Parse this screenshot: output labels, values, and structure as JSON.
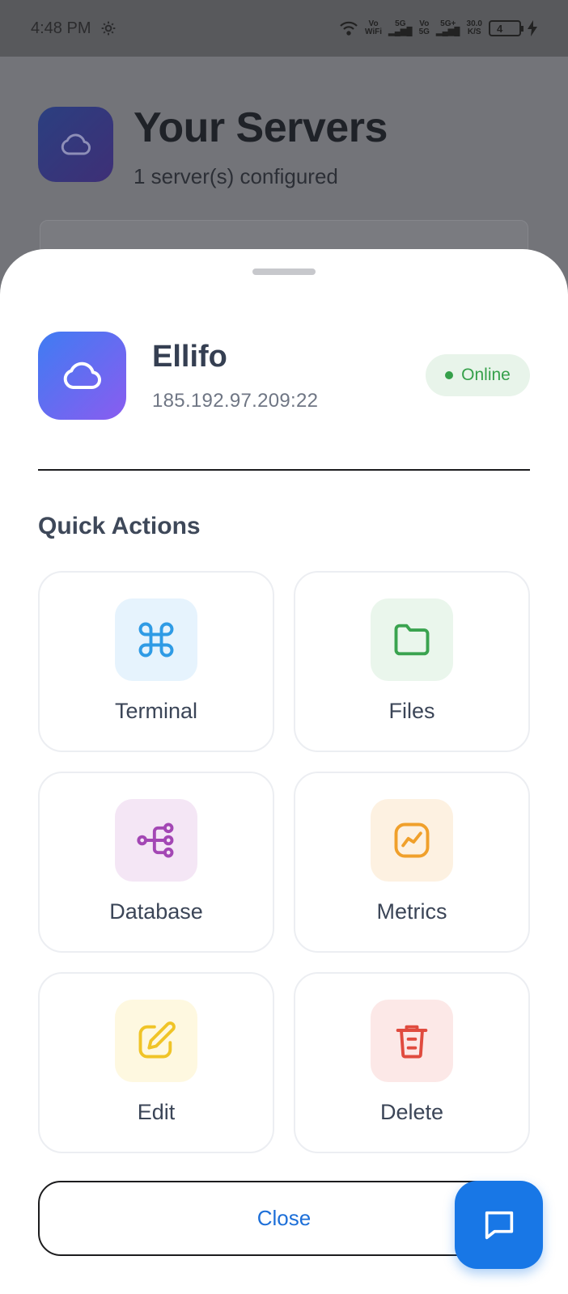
{
  "status_bar": {
    "time": "4:48 PM",
    "net1_top": "Vo",
    "net1_bottom": "WiFi",
    "net2": "5G",
    "net3_top": "Vo",
    "net3_bottom": "5G",
    "net4": "5G+",
    "speed_top": "30.0",
    "speed_bottom": "K/S",
    "battery": "4"
  },
  "background": {
    "title": "Your Servers",
    "subtitle": "1 server(s) configured"
  },
  "server": {
    "name": "Ellifo",
    "address": "185.192.97.209:22",
    "status": "Online"
  },
  "quick_actions": {
    "title": "Quick Actions",
    "items": [
      {
        "label": "Terminal",
        "icon": "command-icon",
        "bg": "#e6f3fd",
        "color": "#2f9be5"
      },
      {
        "label": "Files",
        "icon": "folder-icon",
        "bg": "#eaf6ec",
        "color": "#3aa34f"
      },
      {
        "label": "Database",
        "icon": "tree-icon",
        "bg": "#f4e6f5",
        "color": "#a347b4"
      },
      {
        "label": "Metrics",
        "icon": "chart-icon",
        "bg": "#fdf1e1",
        "color": "#f0a02b"
      },
      {
        "label": "Edit",
        "icon": "edit-icon",
        "bg": "#fef8e0",
        "color": "#f0c427"
      },
      {
        "label": "Delete",
        "icon": "trash-icon",
        "bg": "#fce8e7",
        "color": "#e04b3f"
      }
    ]
  },
  "close_label": "Close",
  "colors": {
    "accent": "#1877e6",
    "online": "#35a04a"
  }
}
